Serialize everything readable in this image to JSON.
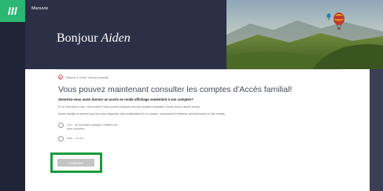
{
  "app": {
    "brand": "Manuvie",
    "greeting_prefix": "Bonjour ",
    "greeting_name": "Aiden"
  },
  "main": {
    "back_link": "Retour à Gérer l'Accès familial",
    "title": "Vous pouvez maintenant consulter les comptes d'Accès familial!",
    "question": "Aimeriez-vous aussi donner un accès en mode affichage seulement à vos comptes?",
    "paragraph1": "Si ce n'est pas le cas, c'est correct! Vous pourrez toujours voir les comptes auxquels Connie vous a donné accès.",
    "paragraph2": "Accès familial ne permet pas non plus d'apporter des modifications à un compte, notamment d'effectuer des virements ou des retraits.",
    "options": [
      {
        "label": "Oui – Je souhaite partager certains de mes comptes"
      },
      {
        "label": "Non – Le for"
      }
    ],
    "continue_label": "Continuer"
  },
  "colors": {
    "rail": "#1f2536",
    "header": "#2b3047",
    "logo": "#2bb673",
    "highlight": "#1a9b3c",
    "button_disabled": "#c4c4c4"
  }
}
